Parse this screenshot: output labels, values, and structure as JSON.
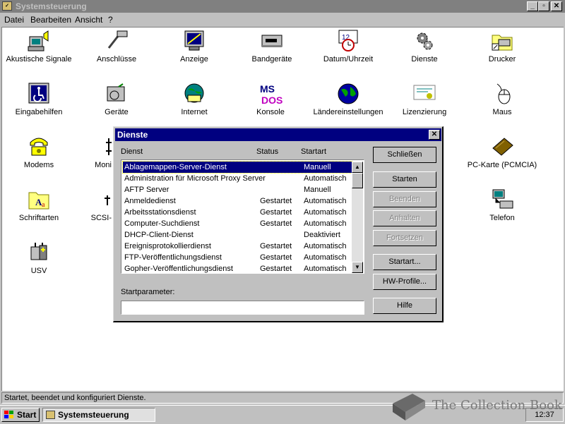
{
  "window": {
    "title": "Systemsteuerung",
    "buttons": {
      "minimize": "_",
      "maximize": "▫",
      "close": "✕"
    }
  },
  "menubar": [
    {
      "label": "Datei"
    },
    {
      "label": "Bearbeiten"
    },
    {
      "label": "Ansicht"
    },
    {
      "label": "?"
    }
  ],
  "icons": [
    {
      "label": "Akustische Signale",
      "icon": "speaker-icon"
    },
    {
      "label": "Anschlüsse",
      "icon": "port-icon"
    },
    {
      "label": "Anzeige",
      "icon": "display-icon"
    },
    {
      "label": "Bandgeräte",
      "icon": "tape-drive-icon"
    },
    {
      "label": "Datum/Uhrzeit",
      "icon": "calendar-clock-icon"
    },
    {
      "label": "Dienste",
      "icon": "gears-icon"
    },
    {
      "label": "Drucker",
      "icon": "printer-folder-icon"
    },
    {
      "label": "Eingabehilfen",
      "icon": "accessibility-icon"
    },
    {
      "label": "Geräte",
      "icon": "devices-icon"
    },
    {
      "label": "Internet",
      "icon": "internet-globe-icon"
    },
    {
      "label": "Konsole",
      "icon": "msdos-icon"
    },
    {
      "label": "Ländereinstellungen",
      "icon": "globe-icon"
    },
    {
      "label": "Lizenzierung",
      "icon": "certificate-icon"
    },
    {
      "label": "Maus",
      "icon": "mouse-icon"
    },
    {
      "label": "Modems",
      "icon": "modem-phone-icon"
    },
    {
      "label": "Moni",
      "icon": "monitor-icon"
    },
    {
      "label": "PC-Karte (PCMCIA)",
      "icon": "pc-card-icon"
    },
    {
      "label": "Schriftarten",
      "icon": "fonts-folder-icon"
    },
    {
      "label": "SCSI-",
      "icon": "scsi-icon"
    },
    {
      "label": "Telefon",
      "icon": "telephony-icon"
    },
    {
      "label": "USV",
      "icon": "ups-battery-icon"
    }
  ],
  "statusbar": {
    "text": "Startet, beendet und konfiguriert Dienste."
  },
  "taskbar": {
    "start": "Start",
    "task": "Systemsteuerung",
    "clock": "12:37"
  },
  "dialog": {
    "title": "Dienste",
    "close": "✕",
    "columns": {
      "service": "Dienst",
      "status": "Status",
      "startup": "Startart"
    },
    "rows": [
      {
        "service": "Ablagemappen-Server-Dienst",
        "status": "",
        "startup": "Manuell",
        "selected": true
      },
      {
        "service": "Administration für Microsoft Proxy Server",
        "status": "",
        "startup": "Automatisch"
      },
      {
        "service": "AFTP Server",
        "status": "",
        "startup": "Manuell"
      },
      {
        "service": "Anmeldedienst",
        "status": "Gestartet",
        "startup": "Automatisch"
      },
      {
        "service": "Arbeitsstationsdienst",
        "status": "Gestartet",
        "startup": "Automatisch"
      },
      {
        "service": "Computer-Suchdienst",
        "status": "Gestartet",
        "startup": "Automatisch"
      },
      {
        "service": "DHCP-Client-Dienst",
        "status": "",
        "startup": "Deaktiviert"
      },
      {
        "service": "Ereignisprotokollierdienst",
        "status": "Gestartet",
        "startup": "Automatisch"
      },
      {
        "service": "FTP-Veröffentlichungsdienst",
        "status": "Gestartet",
        "startup": "Automatisch"
      },
      {
        "service": "Gopher-Veröffentlichungsdienst",
        "status": "Gestartet",
        "startup": "Automatisch"
      }
    ],
    "buttons": {
      "close": "Schließen",
      "start": "Starten",
      "stop": "Beenden",
      "pause": "Anhalten",
      "continue": "Fortsetzen",
      "startup": "Startart...",
      "hwprofiles": "HW-Profile...",
      "help": "Hilfe"
    },
    "param_label": "Startparameter:",
    "param_value": ""
  },
  "watermark": {
    "text": "The Collection Book"
  }
}
